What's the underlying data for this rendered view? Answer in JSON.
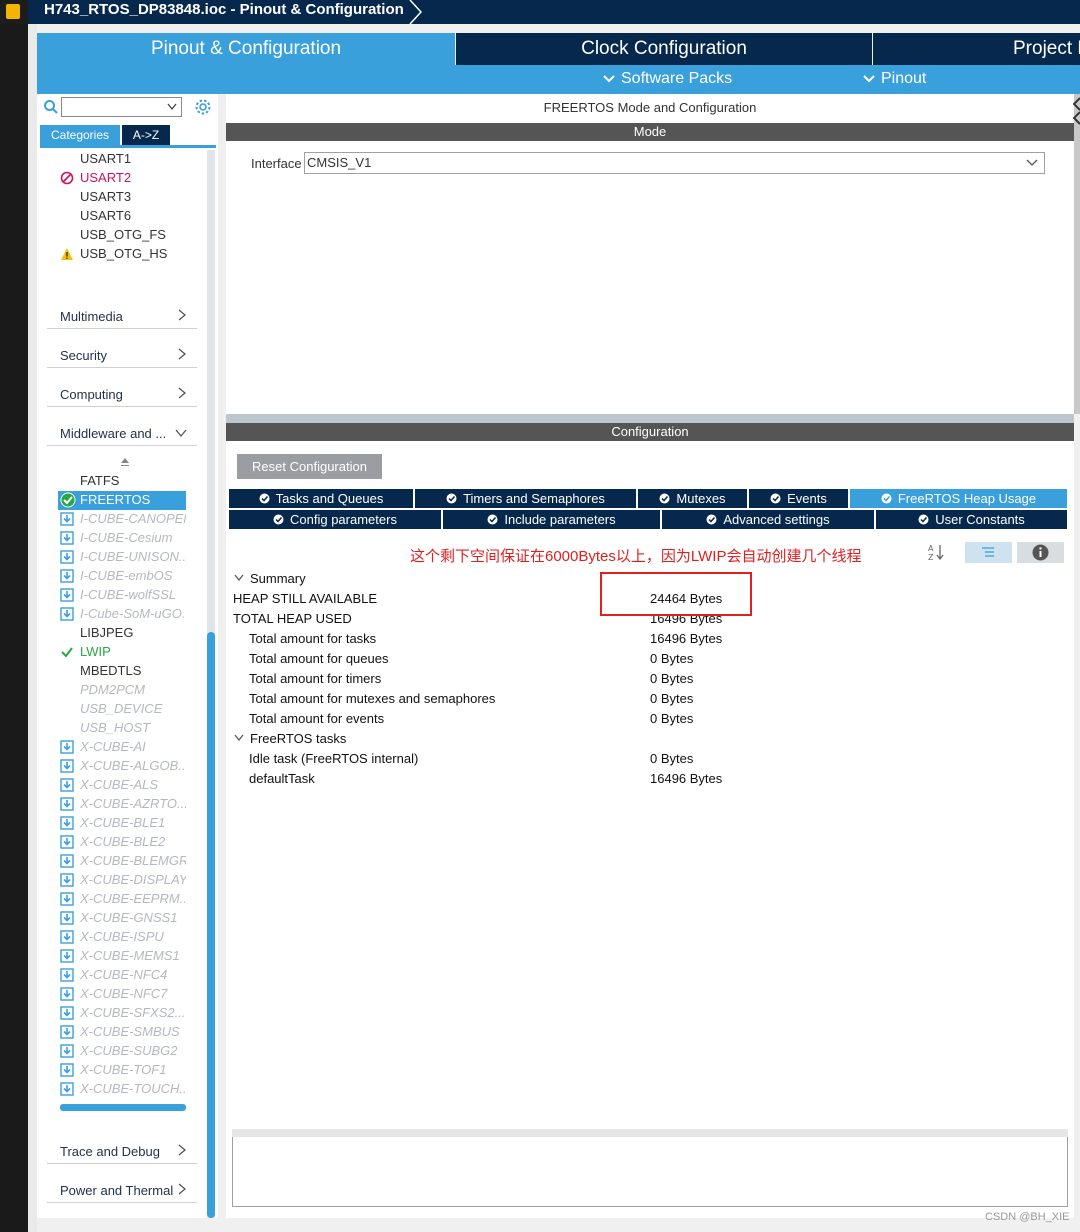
{
  "window": {
    "title": "H743_RTOS_DP83848.ioc - Pinout & Configuration"
  },
  "main_tabs": [
    {
      "label": "Pinout & Configuration"
    },
    {
      "label": "Clock Configuration"
    },
    {
      "label": "Project M"
    }
  ],
  "subbar": {
    "software_packs": "Software Packs",
    "pinout": "Pinout"
  },
  "left": {
    "search": {
      "value": "",
      "placeholder": ""
    },
    "tabs": {
      "categories": "Categories",
      "az": "A->Z"
    },
    "connectivity_items": [
      {
        "label": "USART1",
        "status": "none"
      },
      {
        "label": "USART2",
        "status": "error"
      },
      {
        "label": "USART3",
        "status": "none"
      },
      {
        "label": "USART6",
        "status": "none"
      },
      {
        "label": "USB_OTG_FS",
        "status": "none"
      },
      {
        "label": "USB_OTG_HS",
        "status": "warning"
      }
    ],
    "categories": {
      "multimedia": "Multimedia",
      "security": "Security",
      "computing": "Computing",
      "middleware": "Middleware and ...",
      "trace": "Trace and Debug",
      "power": "Power and Thermal"
    },
    "middleware_items": [
      {
        "label": "FATFS",
        "status": "none"
      },
      {
        "label": "FREERTOS",
        "status": "selected"
      },
      {
        "label": "I-CUBE-CANOPEN",
        "status": "pack"
      },
      {
        "label": "I-CUBE-Cesium",
        "status": "pack"
      },
      {
        "label": "I-CUBE-UNISON...",
        "status": "pack"
      },
      {
        "label": "I-CUBE-embOS",
        "status": "pack"
      },
      {
        "label": "I-CUBE-wolfSSL",
        "status": "pack"
      },
      {
        "label": "I-Cube-SoM-uGO...",
        "status": "pack"
      },
      {
        "label": "LIBJPEG",
        "status": "none"
      },
      {
        "label": "LWIP",
        "status": "ok"
      },
      {
        "label": "MBEDTLS",
        "status": "none"
      },
      {
        "label": "PDM2PCM",
        "status": "disabled"
      },
      {
        "label": "USB_DEVICE",
        "status": "disabled"
      },
      {
        "label": "USB_HOST",
        "status": "disabled"
      },
      {
        "label": "X-CUBE-AI",
        "status": "pack"
      },
      {
        "label": "X-CUBE-ALGOB...",
        "status": "pack"
      },
      {
        "label": "X-CUBE-ALS",
        "status": "pack"
      },
      {
        "label": "X-CUBE-AZRTO...",
        "status": "pack"
      },
      {
        "label": "X-CUBE-BLE1",
        "status": "pack"
      },
      {
        "label": "X-CUBE-BLE2",
        "status": "pack"
      },
      {
        "label": "X-CUBE-BLEMGR",
        "status": "pack"
      },
      {
        "label": "X-CUBE-DISPLAY",
        "status": "pack"
      },
      {
        "label": "X-CUBE-EEPRM...",
        "status": "pack"
      },
      {
        "label": "X-CUBE-GNSS1",
        "status": "pack"
      },
      {
        "label": "X-CUBE-ISPU",
        "status": "pack"
      },
      {
        "label": "X-CUBE-MEMS1",
        "status": "pack"
      },
      {
        "label": "X-CUBE-NFC4",
        "status": "pack"
      },
      {
        "label": "X-CUBE-NFC7",
        "status": "pack"
      },
      {
        "label": "X-CUBE-SFXS2...",
        "status": "pack"
      },
      {
        "label": "X-CUBE-SMBUS",
        "status": "pack"
      },
      {
        "label": "X-CUBE-SUBG2",
        "status": "pack"
      },
      {
        "label": "X-CUBE-TOF1",
        "status": "pack"
      },
      {
        "label": "X-CUBE-TOUCH...",
        "status": "pack"
      }
    ]
  },
  "mode": {
    "title": "FREERTOS Mode and Configuration",
    "bar": "Mode",
    "interface_label": "Interface",
    "interface_value": "CMSIS_V1"
  },
  "config": {
    "bar": "Configuration",
    "reset_label": "Reset Configuration",
    "tabs_row1": [
      {
        "label": "Tasks and Queues"
      },
      {
        "label": "Timers and Semaphores"
      },
      {
        "label": "Mutexes"
      },
      {
        "label": "Events"
      },
      {
        "label": "FreeRTOS Heap Usage"
      }
    ],
    "tabs_row2": [
      {
        "label": "Config parameters"
      },
      {
        "label": "Include parameters"
      },
      {
        "label": "Advanced settings"
      },
      {
        "label": "User Constants"
      }
    ],
    "annotation": "这个剩下空间保证在6000Bytes以上，因为LWIP会自动创建几个线程",
    "tree": {
      "summary_label": "Summary",
      "rows": [
        {
          "label": "HEAP STILL AVAILABLE",
          "value": "24464  Bytes"
        },
        {
          "label": "TOTAL HEAP USED",
          "value": "16496  Bytes"
        },
        {
          "label": "Total amount for tasks",
          "value": "16496  Bytes"
        },
        {
          "label": "Total amount for queues",
          "value": "0  Bytes"
        },
        {
          "label": "Total amount for timers",
          "value": "0  Bytes"
        },
        {
          "label": "Total amount for mutexes and semaphores",
          "value": "0  Bytes"
        },
        {
          "label": "Total amount for events",
          "value": "0  Bytes"
        }
      ],
      "tasks_label": "FreeRTOS tasks",
      "task_rows": [
        {
          "label": "Idle task (FreeRTOS internal)",
          "value": "0  Bytes"
        },
        {
          "label": "defaultTask",
          "value": "16496  Bytes"
        }
      ]
    }
  },
  "watermark": "CSDN @BH_XIE",
  "colors": {
    "navy": "#06284c",
    "accent": "#3aa0dc",
    "error": "#d01060",
    "ok": "#28a745",
    "annotation": "#e02020"
  }
}
